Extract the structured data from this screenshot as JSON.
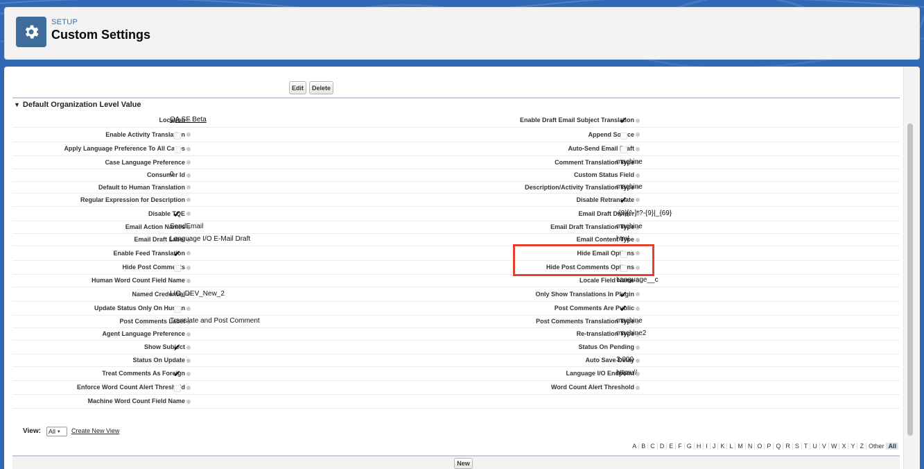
{
  "header": {
    "setup_label": "SETUP",
    "title": "Custom Settings"
  },
  "toolbar": {
    "edit_label": "Edit",
    "delete_label": "Delete"
  },
  "section": {
    "title": "Default Organization Level Value"
  },
  "fields_left": [
    {
      "label": "Location",
      "value": "QA SF Beta",
      "type": "link"
    },
    {
      "label": "Enable Activity Translation",
      "checked": false,
      "type": "checkbox"
    },
    {
      "label": "Apply Language Preference To All Cases",
      "checked": false,
      "type": "checkbox"
    },
    {
      "label": "Case Language Preference",
      "value": "",
      "type": "text"
    },
    {
      "label": "Consumer Id",
      "value": "0",
      "type": "text"
    },
    {
      "label": "Default to Human Translation",
      "value": "",
      "type": "text"
    },
    {
      "label": "Regular Expression for Description",
      "value": "",
      "type": "text"
    },
    {
      "label": "Disable TQE",
      "checked": true,
      "type": "checkbox"
    },
    {
      "label": "Email Action Names",
      "value": "SendEmail",
      "type": "text"
    },
    {
      "label": "Email Draft Label",
      "value": "Language I/O E-Mail Draft",
      "type": "text"
    },
    {
      "label": "Enable Feed Translation",
      "checked": true,
      "type": "checkbox"
    },
    {
      "label": "Hide Post Comments",
      "checked": false,
      "type": "checkbox"
    },
    {
      "label": "Human Word Count Field Name",
      "value": "",
      "type": "text"
    },
    {
      "label": "Named Credential",
      "value": "LIO_DEV_New_2",
      "type": "text"
    },
    {
      "label": "Update Status Only On Human",
      "checked": false,
      "type": "checkbox"
    },
    {
      "label": "Post Comments Label",
      "value": "Translate and Post Comment",
      "type": "text"
    },
    {
      "label": "Agent Language Preference",
      "value": "",
      "type": "text"
    },
    {
      "label": "Show Subject",
      "checked": true,
      "type": "checkbox"
    },
    {
      "label": "Status On Update",
      "value": "",
      "type": "text"
    },
    {
      "label": "Treat Comments As Foreign",
      "checked": true,
      "type": "checkbox"
    },
    {
      "label": "Enforce Word Count Alert Threshold",
      "checked": false,
      "type": "checkbox"
    },
    {
      "label": "Machine Word Count Field Name",
      "value": "",
      "type": "text"
    }
  ],
  "fields_right": [
    {
      "label": "Enable Draft Email Subject Translation",
      "checked": true,
      "type": "checkbox"
    },
    {
      "label": "Append Source",
      "checked": false,
      "type": "checkbox"
    },
    {
      "label": "Auto-Send Email Draft",
      "checked": false,
      "type": "checkbox"
    },
    {
      "label": "Comment Translation Type",
      "value": "machine",
      "type": "text"
    },
    {
      "label": "Custom Status Field",
      "value": "",
      "type": "text"
    },
    {
      "label": "Description/Activity Translation Type",
      "value": "machine",
      "type": "text"
    },
    {
      "label": "Disable Retranslate",
      "checked": true,
      "type": "checkbox"
    },
    {
      "label": "Email Draft Divider",
      "value": "-{9}[^-]*?-{9}|_{69}",
      "type": "text"
    },
    {
      "label": "Email Draft Translation Type",
      "value": "machine",
      "type": "text"
    },
    {
      "label": "Email Content Type",
      "value": "html",
      "type": "text"
    },
    {
      "label": "Hide Email Options",
      "checked": false,
      "type": "checkbox"
    },
    {
      "label": "Hide Post Comments Options",
      "checked": false,
      "type": "checkbox"
    },
    {
      "label": "Locale Field Name",
      "value": "Language__c",
      "type": "text"
    },
    {
      "label": "Only Show Translations In Plugin",
      "checked": true,
      "type": "checkbox"
    },
    {
      "label": "Post Comments Are Public",
      "checked": true,
      "type": "checkbox"
    },
    {
      "label": "Post Comments Translation Type",
      "value": "machine",
      "type": "text"
    },
    {
      "label": "Re-translation Type",
      "value": "machine2",
      "type": "text"
    },
    {
      "label": "Status On Pending",
      "value": "",
      "type": "text"
    },
    {
      "label": "Auto Save Delay",
      "value": "3,000",
      "type": "text"
    },
    {
      "label": "Language I/O Endpoint",
      "value": "https://",
      "type": "text"
    },
    {
      "label": "Word Count Alert Threshold",
      "value": "",
      "type": "text"
    },
    {
      "label": "",
      "value": "",
      "type": "empty"
    }
  ],
  "view": {
    "label": "View:",
    "selected": "All",
    "create_link": "Create New View"
  },
  "alphabet": [
    "A",
    "B",
    "C",
    "D",
    "E",
    "F",
    "G",
    "H",
    "I",
    "J",
    "K",
    "L",
    "M",
    "N",
    "O",
    "P",
    "Q",
    "R",
    "S",
    "T",
    "U",
    "V",
    "W",
    "X",
    "Y",
    "Z",
    "Other",
    "All"
  ],
  "alphabet_selected": "All",
  "new_button": "New",
  "colors": {
    "background": "#2f68b4",
    "setup_icon": "#3e6d9c",
    "highlight": "#e2422c"
  },
  "icons": {
    "setup": "gear-icon",
    "section_toggle": "triangle-down-icon",
    "info": "info-icon",
    "checkmark": "checkmark-icon"
  }
}
